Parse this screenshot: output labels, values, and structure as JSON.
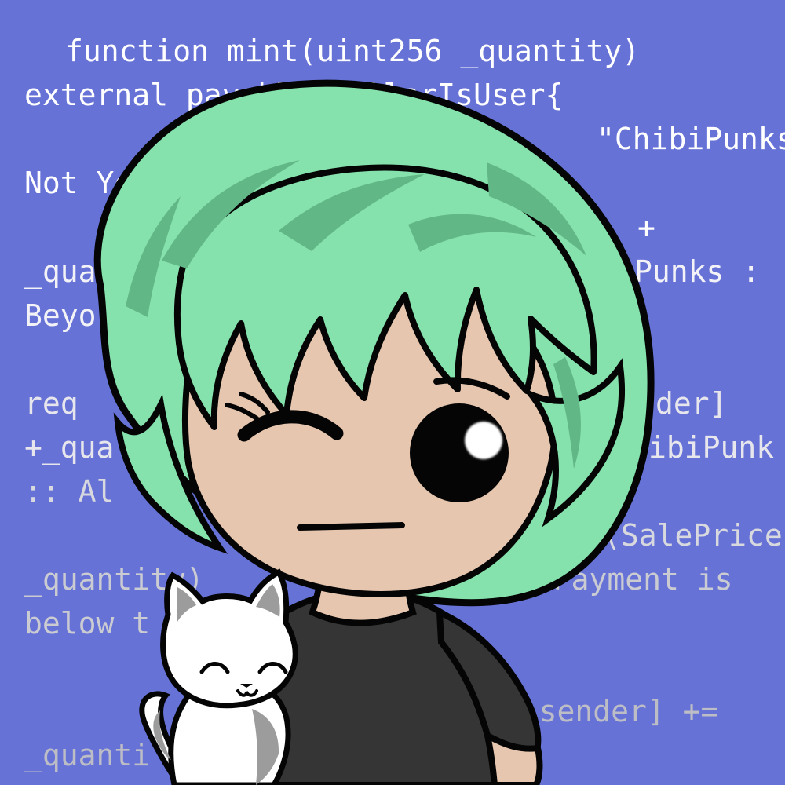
{
  "background": {
    "color": "#6672d6",
    "code_lines": [
      "function mint(uint256 _quantity)",
      "external payable callerIsUser{",
      "\"ChibiPunks",
      "Not Ye",
      "+",
      "_qua",
      "Punks :",
      "Beyo",
      "req",
      "der]",
      "+_qua",
      "ibiPunk",
      ":: Al",
      "(SalePrice",
      "_quantity)",
      ": Payment is",
      "below t",
      "sg.sender] +=",
      "_quanti"
    ]
  },
  "avatar": {
    "hair_color": "#86e2ad",
    "hair_shadow": "#62b786",
    "skin_color": "#e7c6af",
    "shirt_color": "#353535",
    "outline_color": "#050505",
    "cat_color": "#ffffff",
    "cat_accent": "#9c9c9c"
  }
}
